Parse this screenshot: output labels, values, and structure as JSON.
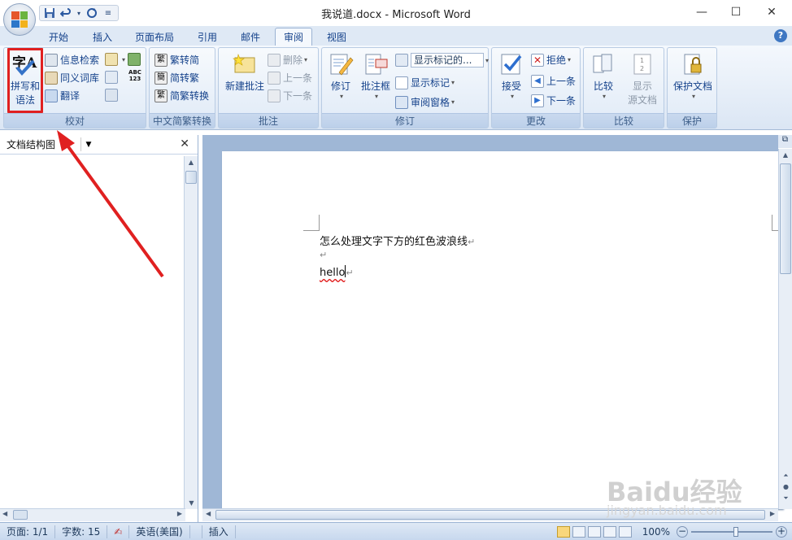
{
  "window": {
    "title": "我说道.docx - Microsoft Word",
    "controls": [
      "minimize",
      "maximize",
      "close"
    ]
  },
  "qat": [
    "save-icon",
    "undo-icon",
    "redo-icon",
    "customize-icon"
  ],
  "tabs": [
    {
      "label": "开始",
      "active": false
    },
    {
      "label": "插入",
      "active": false
    },
    {
      "label": "页面布局",
      "active": false
    },
    {
      "label": "引用",
      "active": false
    },
    {
      "label": "邮件",
      "active": false
    },
    {
      "label": "审阅",
      "active": true
    },
    {
      "label": "视图",
      "active": false
    }
  ],
  "ribbon": {
    "proofing": {
      "label": "校对",
      "spelling_icon_text": "字A",
      "spelling_l1": "拼写和",
      "spelling_l2": "语法",
      "research": "信息检索",
      "thesaurus": "同义词库",
      "translate": "翻译",
      "wordcount_icon_text": "ABC\n123"
    },
    "chinese": {
      "label": "中文简繁转换",
      "t2s": "繁转简",
      "s2t": "简转繁",
      "convert": "简繁转换"
    },
    "comments": {
      "label": "批注",
      "new_l1": "新建批注",
      "delete": "删除",
      "prev": "上一条",
      "next": "下一条"
    },
    "tracking": {
      "label": "修订",
      "track_changes": "修订",
      "balloons": "批注框",
      "display_select": "显示标记的...",
      "show_markup": "显示标记",
      "reviewing_pane": "审阅窗格"
    },
    "changes": {
      "label": "更改",
      "accept": "接受",
      "reject": "拒绝",
      "prev": "上一条",
      "next": "下一条"
    },
    "compare": {
      "label": "比较",
      "compare": "比较",
      "show_source_l1": "显示",
      "show_source_l2": "源文档"
    },
    "protect": {
      "label": "保护",
      "protect_doc": "保护文档"
    }
  },
  "navpane": {
    "title": "文档结构图"
  },
  "document": {
    "line1": "怎么处理文字下方的红色波浪线",
    "line3": "hello"
  },
  "status": {
    "page": "页面: 1/1",
    "words": "字数: 15",
    "language": "英语(美国)",
    "mode": "插入",
    "zoom": "100%"
  },
  "watermark": {
    "logo": "Baidu经验",
    "url": "jingyan.baidu.com"
  },
  "colors": {
    "highlight_red": "#e02020",
    "ribbon_text": "#15428b",
    "doc_bg": "#9fb7d6"
  }
}
